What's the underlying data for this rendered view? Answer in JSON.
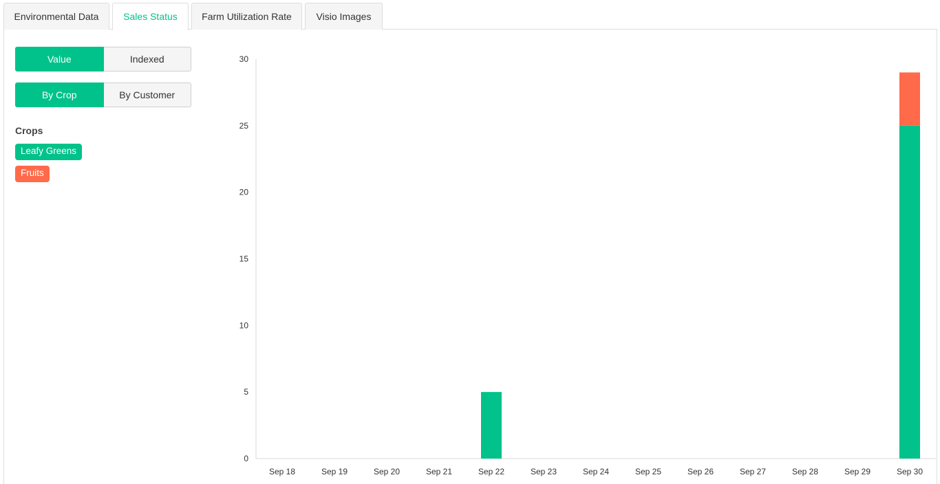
{
  "tabs": [
    {
      "label": "Environmental Data",
      "active": false
    },
    {
      "label": "Sales Status",
      "active": true
    },
    {
      "label": "Farm Utilization Rate",
      "active": false
    },
    {
      "label": "Visio Images",
      "active": false
    }
  ],
  "controls": {
    "mode": {
      "value_label": "Value",
      "indexed_label": "Indexed",
      "selected": "Value"
    },
    "grouping": {
      "by_crop_label": "By Crop",
      "by_customer_label": "By Customer",
      "selected": "By Crop"
    }
  },
  "legend": {
    "title": "Crops",
    "items": [
      {
        "label": "Leafy Greens",
        "color": "#00c28a"
      },
      {
        "label": "Fruits",
        "color": "#ff6a4a"
      }
    ]
  },
  "colors": {
    "accent": "#00c28a",
    "fruits": "#ff6a4a"
  },
  "chart_data": {
    "type": "bar",
    "stacked": true,
    "categories": [
      "Sep 18",
      "Sep 19",
      "Sep 20",
      "Sep 21",
      "Sep 22",
      "Sep 23",
      "Sep 24",
      "Sep 25",
      "Sep 26",
      "Sep 27",
      "Sep 28",
      "Sep 29",
      "Sep 30"
    ],
    "series": [
      {
        "name": "Leafy Greens",
        "color": "#00c28a",
        "values": [
          0,
          0,
          0,
          0,
          5,
          0,
          0,
          0,
          0,
          0,
          0,
          0,
          25
        ]
      },
      {
        "name": "Fruits",
        "color": "#ff6a4a",
        "values": [
          0,
          0,
          0,
          0,
          0,
          0,
          0,
          0,
          0,
          0,
          0,
          0,
          4
        ]
      }
    ],
    "yticks": [
      0,
      5,
      10,
      15,
      20,
      25,
      30
    ],
    "ylim": [
      0,
      30
    ],
    "grid": false
  }
}
